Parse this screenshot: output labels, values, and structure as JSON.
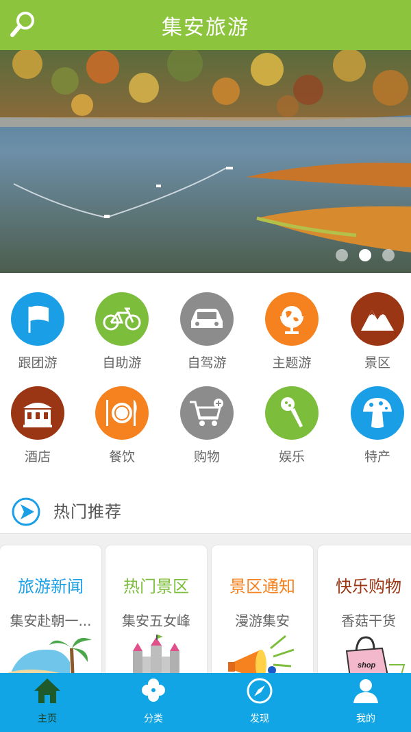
{
  "app": {
    "title": "集安旅游"
  },
  "banner": {
    "slides": 3,
    "active_index": 1
  },
  "categories": [
    {
      "label": "跟团游",
      "icon": "flag-icon",
      "color": "#1a9fe6"
    },
    {
      "label": "自助游",
      "icon": "bicycle-icon",
      "color": "#7dbd3c"
    },
    {
      "label": "自驾游",
      "icon": "car-icon",
      "color": "#8c8c8c"
    },
    {
      "label": "主题游",
      "icon": "globe-icon",
      "color": "#f5821f"
    },
    {
      "label": "景区",
      "icon": "mountain-icon",
      "color": "#9b3614"
    },
    {
      "label": "酒店",
      "icon": "hotel-icon",
      "color": "#9b3614"
    },
    {
      "label": "餐饮",
      "icon": "dining-icon",
      "color": "#f5821f"
    },
    {
      "label": "购物",
      "icon": "cart-icon",
      "color": "#8c8c8c"
    },
    {
      "label": "娱乐",
      "icon": "microphone-icon",
      "color": "#7dbd3c"
    },
    {
      "label": "特产",
      "icon": "mushroom-icon",
      "color": "#1a9fe6"
    }
  ],
  "hot": {
    "title": "热门推荐"
  },
  "cards": [
    {
      "title": "旅游新闻",
      "subtitle": "集安赴朝一...",
      "color": "#1a9fe6",
      "icon": "beach-palm-icon"
    },
    {
      "title": "热门景区",
      "subtitle": "集安五女峰",
      "color": "#7dbd3c",
      "icon": "castle-icon"
    },
    {
      "title": "景区通知",
      "subtitle": "漫游集安",
      "color": "#f5821f",
      "icon": "megaphone-icon"
    },
    {
      "title": "快乐购物",
      "subtitle": "香菇干货",
      "color": "#9b3614",
      "icon": "shopping-bag-icon"
    }
  ],
  "tabs": [
    {
      "label": "主页",
      "icon": "home-icon",
      "active": true
    },
    {
      "label": "分类",
      "icon": "clover-icon",
      "active": false
    },
    {
      "label": "发现",
      "icon": "compass-icon",
      "active": false
    },
    {
      "label": "我的",
      "icon": "user-icon",
      "active": false
    }
  ]
}
